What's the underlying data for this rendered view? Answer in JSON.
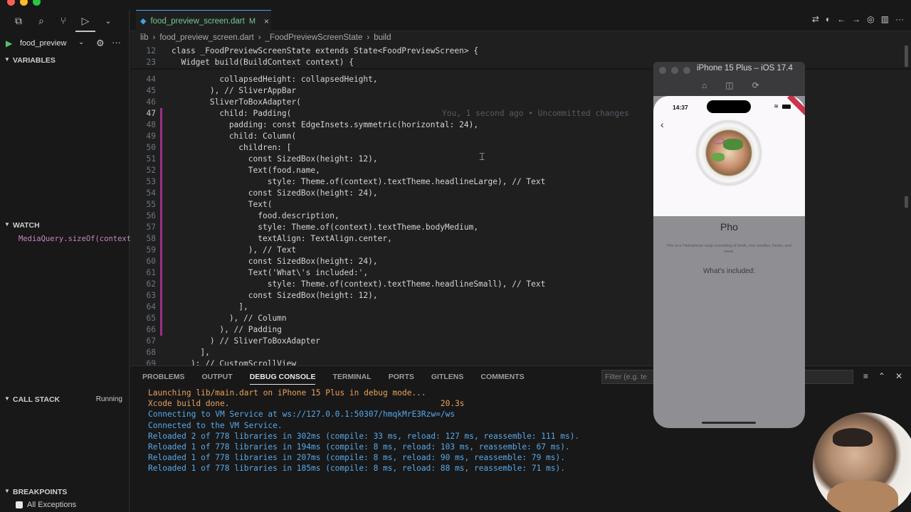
{
  "sidebar": {
    "run_config": "food_preview",
    "sections": {
      "variables": "VARIABLES",
      "watch": "WATCH",
      "call_stack": "CALL STACK",
      "call_stack_status": "Running",
      "breakpoints": "BREAKPOINTS"
    },
    "watch_expression": "MediaQuery.sizeOf(context)",
    "breakpoint_item": "All Exceptions"
  },
  "editor": {
    "tab": {
      "name": "food_preview_screen.dart",
      "modified": "M"
    },
    "breadcrumb": [
      "lib",
      "food_preview_screen.dart",
      "_FoodPreviewScreenState",
      "build"
    ],
    "sticky_lines": [
      {
        "n": "12",
        "text": "class _FoodPreviewScreenState extends State<FoodPreviewScreen> {"
      },
      {
        "n": "23",
        "text": "  Widget build(BuildContext context) {"
      }
    ],
    "lines": [
      {
        "n": "44",
        "text": "          collapsedHeight: collapsedHeight,"
      },
      {
        "n": "45",
        "text": "        ), // SliverAppBar"
      },
      {
        "n": "46",
        "text": "        SliverToBoxAdapter("
      },
      {
        "n": "47",
        "text": "          child: Padding(",
        "blame": "You, 1 second ago • Uncommitted changes"
      },
      {
        "n": "48",
        "text": "            padding: const EdgeInsets.symmetric(horizontal: 24),"
      },
      {
        "n": "49",
        "text": "            child: Column("
      },
      {
        "n": "50",
        "text": "              children: ["
      },
      {
        "n": "51",
        "text": "                const SizedBox(height: 12),"
      },
      {
        "n": "52",
        "text": "                Text(food.name,"
      },
      {
        "n": "53",
        "text": "                    style: Theme.of(context).textTheme.headlineLarge), // Text"
      },
      {
        "n": "54",
        "text": "                const SizedBox(height: 24),"
      },
      {
        "n": "55",
        "text": "                Text("
      },
      {
        "n": "56",
        "text": "                  food.description,"
      },
      {
        "n": "57",
        "text": "                  style: Theme.of(context).textTheme.bodyMedium,"
      },
      {
        "n": "58",
        "text": "                  textAlign: TextAlign.center,"
      },
      {
        "n": "59",
        "text": "                ), // Text"
      },
      {
        "n": "60",
        "text": "                const SizedBox(height: 24),"
      },
      {
        "n": "61",
        "text": "                Text('What\\'s included:',"
      },
      {
        "n": "62",
        "text": "                    style: Theme.of(context).textTheme.headlineSmall), // Text"
      },
      {
        "n": "63",
        "text": "                const SizedBox(height: 12),"
      },
      {
        "n": "64",
        "text": "              ],"
      },
      {
        "n": "65",
        "text": "            ), // Column"
      },
      {
        "n": "66",
        "text": "          ), // Padding"
      },
      {
        "n": "67",
        "text": "        ) // SliverToBoxAdapter"
      },
      {
        "n": "68",
        "text": "      ],"
      },
      {
        "n": "69",
        "text": "    ); // CustomScrollView"
      }
    ],
    "current_line": "47"
  },
  "panel": {
    "tabs": [
      "PROBLEMS",
      "OUTPUT",
      "DEBUG CONSOLE",
      "TERMINAL",
      "PORTS",
      "GITLENS",
      "COMMENTS"
    ],
    "active_tab": "DEBUG CONSOLE",
    "filter_placeholder": "Filter (e.g. te",
    "console": [
      {
        "text": "Launching lib/main.dart on iPhone 15 Plus in debug mode...",
        "color": "orange"
      },
      {
        "text": "Xcode build done.                                            20.3s",
        "color": "orange"
      },
      {
        "text": "Connecting to VM Service at ws://127.0.0.1:50307/hmqkMrE3Rzw=/ws",
        "color": "blue"
      },
      {
        "text": "Connected to the VM Service.",
        "color": "blue"
      },
      {
        "text": "Reloaded 2 of 778 libraries in 302ms (compile: 33 ms, reload: 127 ms, reassemble: 111 ms).",
        "color": "blue"
      },
      {
        "text": "Reloaded 1 of 778 libraries in 194ms (compile: 8 ms, reload: 103 ms, reassemble: 67 ms).",
        "color": "blue"
      },
      {
        "text": "Reloaded 1 of 778 libraries in 207ms (compile: 8 ms, reload: 90 ms, reassemble: 79 ms).",
        "color": "blue"
      },
      {
        "text": "Reloaded 1 of 778 libraries in 185ms (compile: 8 ms, reload: 88 ms, reassemble: 71 ms).",
        "color": "blue"
      }
    ]
  },
  "simulator": {
    "title": "iPhone 15 Plus – iOS 17.4",
    "status_time": "14:37",
    "food_name": "Pho",
    "description": "Pho is a Vietnamese soup consisting of broth, rice noodles, herbs, and meat.",
    "included_label": "What's included:"
  },
  "colors": {
    "accent": "#4aa3ff",
    "console_orange": "#e8a15c",
    "console_blue": "#56a8ea",
    "modified": "#73c991"
  }
}
